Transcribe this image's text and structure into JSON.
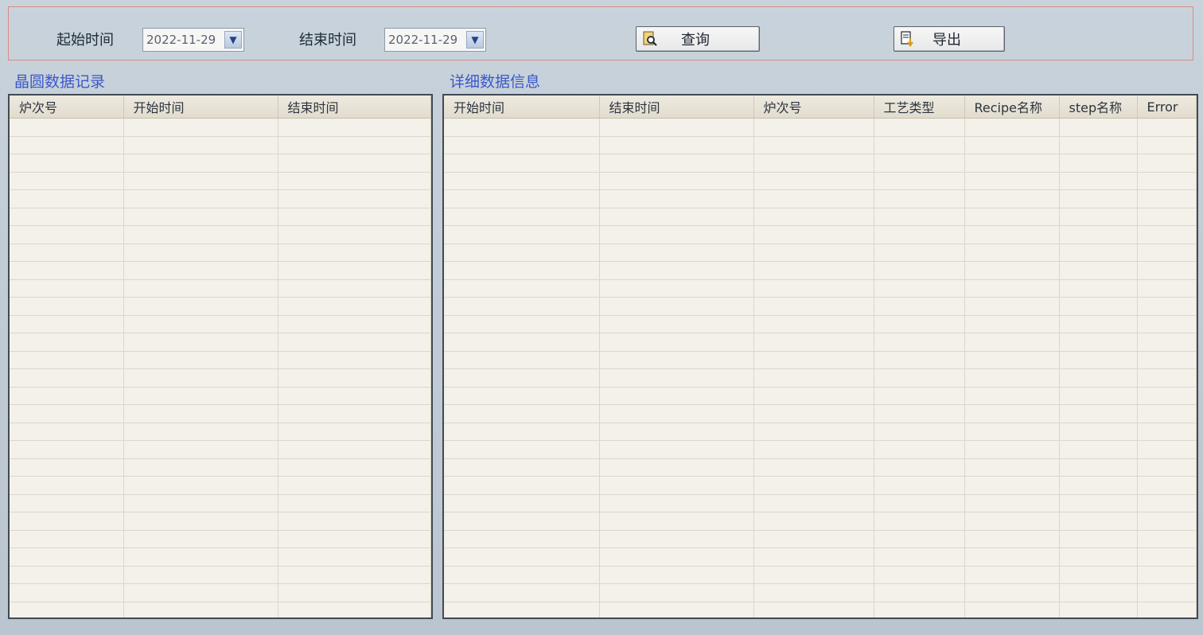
{
  "toolbar": {
    "start_label": "起始时间",
    "start_date": "2022-11-29",
    "end_label": "结束时间",
    "end_date": "2022-11-29",
    "query_label": "查询",
    "export_label": "导出",
    "dropdown_icon": "chevron-down-icon",
    "query_icon": "search-document-icon",
    "export_icon": "export-document-icon"
  },
  "left_panel": {
    "title": "晶圆数据记录",
    "columns": [
      "炉次号",
      "开始时间",
      "结束时间"
    ],
    "rows": []
  },
  "right_panel": {
    "title": "详细数据信息",
    "columns": [
      "开始时间",
      "结束时间",
      "炉次号",
      "工艺类型",
      "Recipe名称",
      "step名称",
      "Error"
    ],
    "rows": []
  },
  "colors": {
    "background": "#c2ccd6",
    "toolbar_border": "#d98a85",
    "section_title": "#3c58c8",
    "grid_background": "#f4f1ea"
  }
}
